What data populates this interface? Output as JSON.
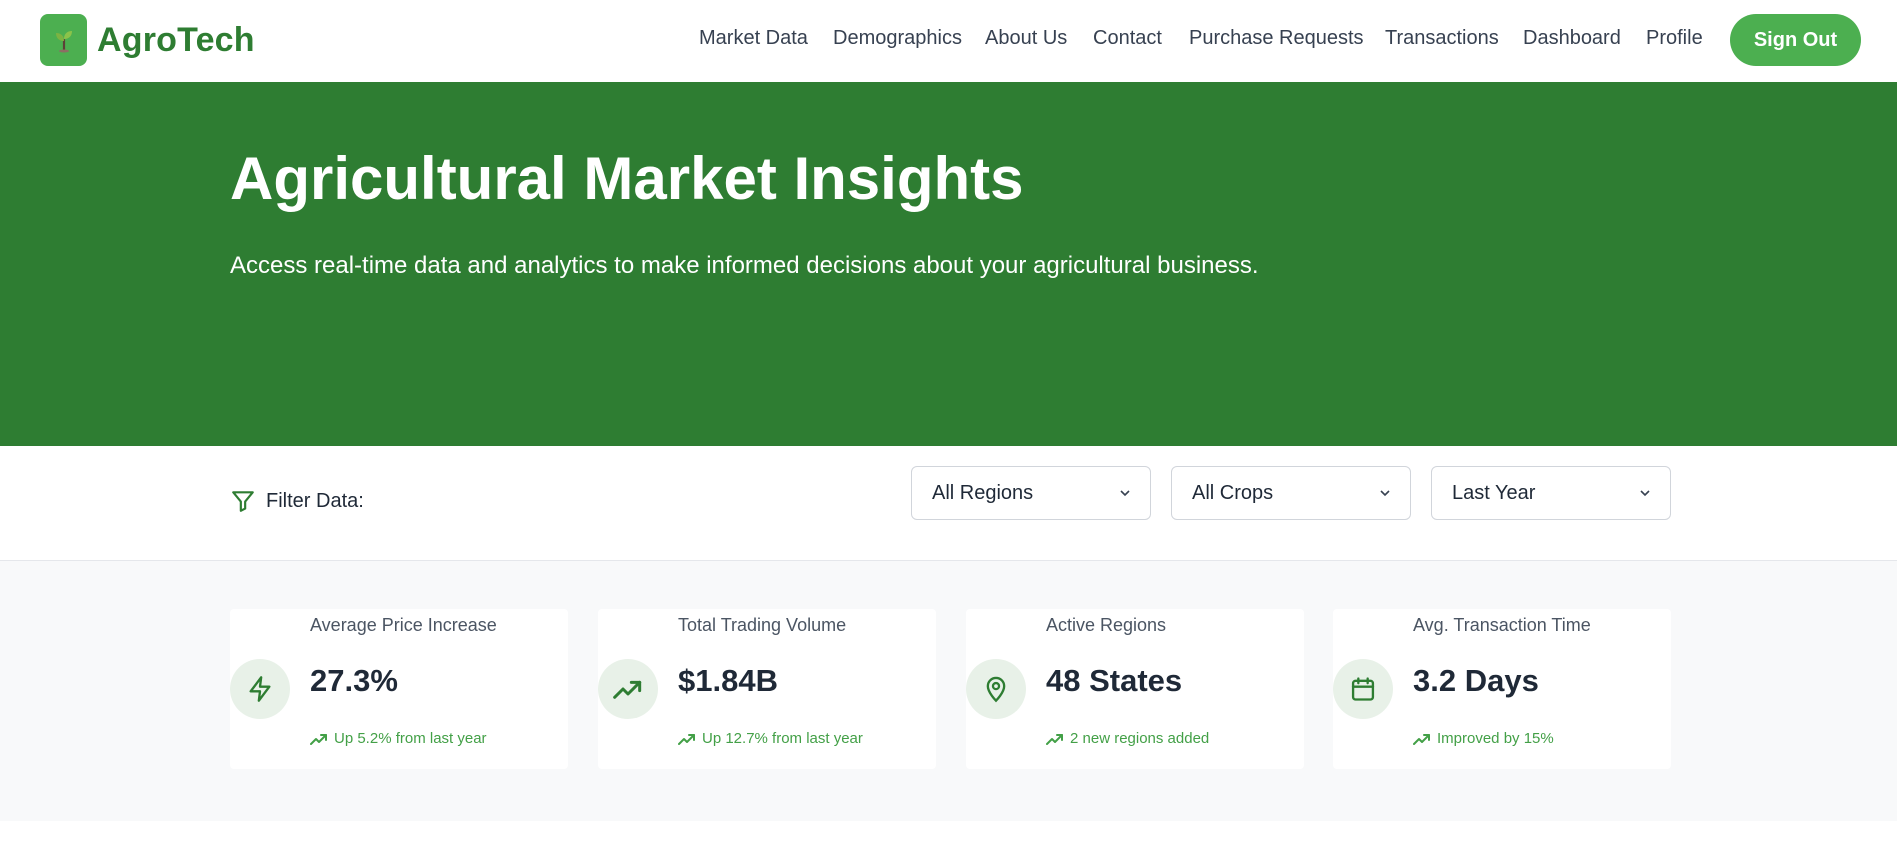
{
  "brand": {
    "name": "AgroTech",
    "logo_icon": "seedling-icon"
  },
  "nav": {
    "items": [
      {
        "label": "Market Data"
      },
      {
        "label": "Demographics"
      },
      {
        "label": "About Us"
      },
      {
        "label": "Contact"
      },
      {
        "label": "Purchase Requests"
      },
      {
        "label": "Transactions"
      },
      {
        "label": "Dashboard"
      },
      {
        "label": "Profile"
      }
    ],
    "signout_label": "Sign Out"
  },
  "hero": {
    "title": "Agricultural Market Insights",
    "subtitle": "Access real-time data and analytics to make informed decisions about your agricultural business."
  },
  "filters": {
    "label": "Filter Data:",
    "region": "All Regions",
    "crop": "All Crops",
    "period": "Last Year"
  },
  "stats": [
    {
      "label": "Average Price Increase",
      "value": "27.3%",
      "trend": "Up 5.2% from last year",
      "icon": "lightning-icon"
    },
    {
      "label": "Total Trading Volume",
      "value": "$1.84B",
      "trend": "Up 12.7% from last year",
      "icon": "trending-up-icon"
    },
    {
      "label": "Active Regions",
      "value": "48 States",
      "trend": "2 new regions added",
      "icon": "map-pin-icon"
    },
    {
      "label": "Avg. Transaction Time",
      "value": "3.2 Days",
      "trend": "Improved by 15%",
      "icon": "calendar-icon"
    }
  ],
  "colors": {
    "brand_green": "#2e7d32",
    "accent_green": "#4caf50",
    "trend_green": "#43a047",
    "icon_bg": "#e8f1e8",
    "stats_bg": "#f8f9fa"
  }
}
